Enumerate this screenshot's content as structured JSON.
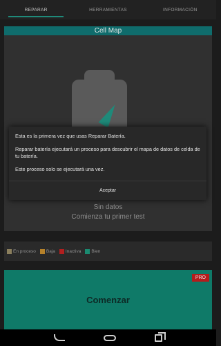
{
  "tabs": [
    {
      "label": "REPARAR",
      "active": true
    },
    {
      "label": "HERRAMIENTAS",
      "active": false
    },
    {
      "label": "INFORMACIÓN",
      "active": false
    }
  ],
  "cell_map": {
    "title": "Cell Map",
    "empty_line1": "Sin datos",
    "empty_line2": "Comienza tu primer test"
  },
  "legend": [
    {
      "label": "En proceso",
      "color": "#8b7f5d"
    },
    {
      "label": "Baja",
      "color": "#b5812a"
    },
    {
      "label": "Inactiva",
      "color": "#b11f1f"
    },
    {
      "label": "Bien",
      "color": "#1a8a70"
    }
  ],
  "start": {
    "label": "Comenzar",
    "badge": "PRO"
  },
  "dialog": {
    "paragraph1": "Esta es la primera vez que usas Reparar Batería.",
    "paragraph2": "Reparar batería ejecutará un proceso para descubrir el mapa de datos de celda de tu batería.",
    "paragraph3": "Este proceso solo se ejecutará una vez.",
    "button": "Aceptar"
  },
  "colors": {
    "accent": "#0f7a68",
    "header": "#0f6c6c",
    "pro_badge": "#b51c1c"
  }
}
